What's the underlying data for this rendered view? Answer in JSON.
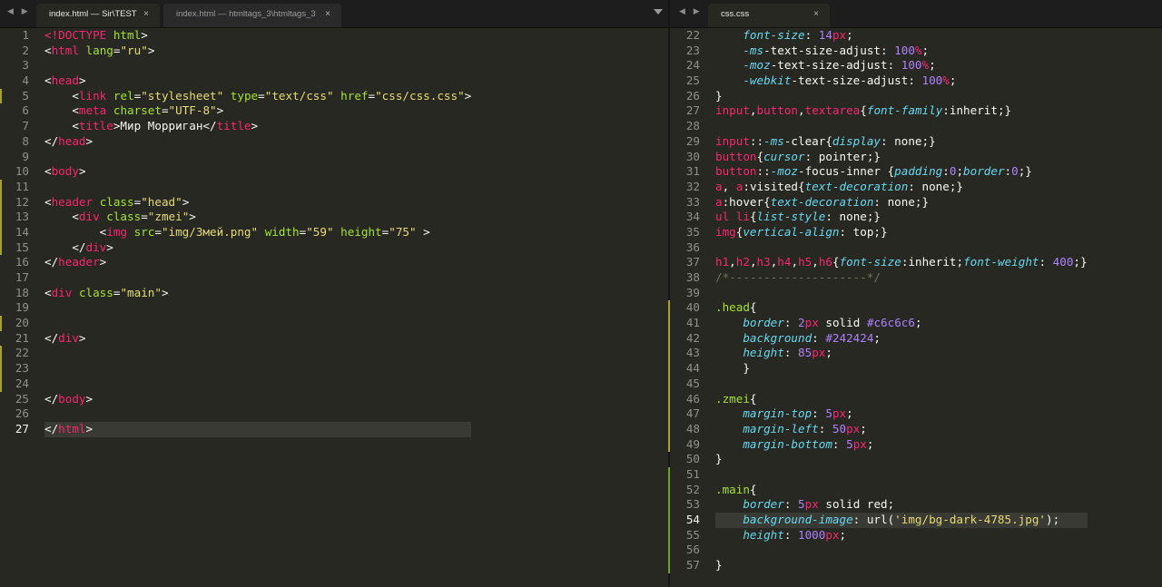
{
  "tabs": {
    "left": [
      {
        "label": "index.html — Sir\\TEST",
        "active": true
      },
      {
        "label": "index.html — htmltags_3\\htmltags_3",
        "active": false
      }
    ],
    "right": [
      {
        "label": "css.css",
        "active": true
      }
    ]
  },
  "icons": {
    "nav_arrows": "nav-arrows-icon",
    "close": "close-icon",
    "dropdown": "chevron-down-icon"
  },
  "colors": {
    "tag": "#f92672",
    "attribute": "#a6e22e",
    "string": "#e6db74",
    "property": "#66d9ef",
    "number": "#ae81ff",
    "comment": "#75715e",
    "background": "#272822",
    "gutter_modified": "#a6a22d",
    "gutter_added": "#6fa02a"
  },
  "html_editor": {
    "first_line": 1,
    "lines": [
      [
        [
          "t",
          "<!"
        ],
        [
          "t",
          "DOCTYPE"
        ],
        [
          "w",
          " "
        ],
        [
          "a",
          "html"
        ],
        [
          "w",
          ">"
        ]
      ],
      [
        [
          "w",
          "<"
        ],
        [
          "t",
          "html"
        ],
        [
          "w",
          " "
        ],
        [
          "a",
          "lang"
        ],
        [
          "w",
          "="
        ],
        [
          "s",
          "\"ru\""
        ],
        [
          "w",
          ">"
        ]
      ],
      [],
      [
        [
          "w",
          "<"
        ],
        [
          "t",
          "head"
        ],
        [
          "w",
          ">"
        ]
      ],
      [
        [
          "w",
          "    <"
        ],
        [
          "t",
          "link"
        ],
        [
          "w",
          " "
        ],
        [
          "a",
          "rel"
        ],
        [
          "w",
          "="
        ],
        [
          "s",
          "\"stylesheet\""
        ],
        [
          "w",
          " "
        ],
        [
          "a",
          "type"
        ],
        [
          "w",
          "="
        ],
        [
          "s",
          "\"text/css\""
        ],
        [
          "w",
          " "
        ],
        [
          "a",
          "href"
        ],
        [
          "w",
          "="
        ],
        [
          "s",
          "\"css/css.css\""
        ],
        [
          "w",
          ">"
        ]
      ],
      [
        [
          "w",
          "    <"
        ],
        [
          "t",
          "meta"
        ],
        [
          "w",
          " "
        ],
        [
          "a",
          "charset"
        ],
        [
          "w",
          "="
        ],
        [
          "s",
          "\"UTF-8\""
        ],
        [
          "w",
          ">"
        ]
      ],
      [
        [
          "w",
          "    <"
        ],
        [
          "t",
          "title"
        ],
        [
          "w",
          ">Мир Морриган</"
        ],
        [
          "t",
          "title"
        ],
        [
          "w",
          ">"
        ]
      ],
      [
        [
          "w",
          "</"
        ],
        [
          "t",
          "head"
        ],
        [
          "w",
          ">"
        ]
      ],
      [],
      [
        [
          "w",
          "<"
        ],
        [
          "t",
          "body"
        ],
        [
          "w",
          ">"
        ]
      ],
      [],
      [
        [
          "w",
          "<"
        ],
        [
          "t",
          "header"
        ],
        [
          "w",
          " "
        ],
        [
          "a",
          "class"
        ],
        [
          "w",
          "="
        ],
        [
          "s",
          "\"head\""
        ],
        [
          "w",
          ">"
        ]
      ],
      [
        [
          "w",
          "    <"
        ],
        [
          "t",
          "div"
        ],
        [
          "w",
          " "
        ],
        [
          "a",
          "class"
        ],
        [
          "w",
          "="
        ],
        [
          "s",
          "\"zmei\""
        ],
        [
          "w",
          ">"
        ]
      ],
      [
        [
          "w",
          "        <"
        ],
        [
          "t",
          "img"
        ],
        [
          "w",
          " "
        ],
        [
          "a",
          "src"
        ],
        [
          "w",
          "="
        ],
        [
          "s",
          "\"img/Змей.png\""
        ],
        [
          "w",
          " "
        ],
        [
          "a",
          "width"
        ],
        [
          "w",
          "="
        ],
        [
          "s",
          "\"59\""
        ],
        [
          "w",
          " "
        ],
        [
          "a",
          "height"
        ],
        [
          "w",
          "="
        ],
        [
          "s",
          "\"75\""
        ],
        [
          "w",
          " >"
        ]
      ],
      [
        [
          "w",
          "    </"
        ],
        [
          "t",
          "div"
        ],
        [
          "w",
          ">"
        ]
      ],
      [
        [
          "w",
          "</"
        ],
        [
          "t",
          "header"
        ],
        [
          "w",
          ">"
        ]
      ],
      [],
      [
        [
          "w",
          "<"
        ],
        [
          "t",
          "div"
        ],
        [
          "w",
          " "
        ],
        [
          "a",
          "class"
        ],
        [
          "w",
          "="
        ],
        [
          "s",
          "\"main\""
        ],
        [
          "w",
          ">"
        ]
      ],
      [],
      [],
      [
        [
          "w",
          "</"
        ],
        [
          "t",
          "div"
        ],
        [
          "w",
          ">"
        ]
      ],
      [],
      [],
      [],
      [
        [
          "w",
          "</"
        ],
        [
          "t",
          "body"
        ],
        [
          "w",
          ">"
        ]
      ],
      [],
      [
        [
          "w",
          "</"
        ],
        [
          "t",
          "html"
        ],
        [
          "w",
          ">"
        ]
      ]
    ],
    "modified_lines": [
      5,
      11,
      12,
      13,
      14,
      15,
      20,
      22,
      23,
      24
    ],
    "current_line": 27
  },
  "css_editor": {
    "first_line": 22,
    "lines": [
      [
        [
          "w",
          "    "
        ],
        [
          "p",
          "font-size"
        ],
        [
          "w",
          ": "
        ],
        [
          "n",
          "14"
        ],
        [
          "t",
          "px"
        ],
        [
          "w",
          ";"
        ]
      ],
      [
        [
          "w",
          "    "
        ],
        [
          "p",
          "-ms"
        ],
        [
          "w",
          "-text-size-adjust: "
        ],
        [
          "n",
          "100"
        ],
        [
          "t",
          "%"
        ],
        [
          "w",
          ";"
        ]
      ],
      [
        [
          "w",
          "    "
        ],
        [
          "p",
          "-moz"
        ],
        [
          "w",
          "-text-size-adjust: "
        ],
        [
          "n",
          "100"
        ],
        [
          "t",
          "%"
        ],
        [
          "w",
          ";"
        ]
      ],
      [
        [
          "w",
          "    "
        ],
        [
          "p",
          "-webkit"
        ],
        [
          "w",
          "-text-size-adjust: "
        ],
        [
          "n",
          "100"
        ],
        [
          "t",
          "%"
        ],
        [
          "w",
          ";"
        ]
      ],
      [
        [
          "w",
          "}"
        ]
      ],
      [
        [
          "t",
          "input"
        ],
        [
          "w",
          ","
        ],
        [
          "t",
          "button"
        ],
        [
          "w",
          ","
        ],
        [
          "t",
          "textarea"
        ],
        [
          "w",
          "{"
        ],
        [
          "p",
          "font-family"
        ],
        [
          "w",
          ":inherit;}"
        ]
      ],
      [],
      [
        [
          "t",
          "input"
        ],
        [
          "w",
          "::"
        ],
        [
          "p",
          "-ms"
        ],
        [
          "w",
          "-clear{"
        ],
        [
          "p",
          "display"
        ],
        [
          "w",
          ": none;}"
        ]
      ],
      [
        [
          "t",
          "button"
        ],
        [
          "w",
          "{"
        ],
        [
          "p",
          "cursor"
        ],
        [
          "w",
          ": pointer;}"
        ]
      ],
      [
        [
          "t",
          "button"
        ],
        [
          "w",
          "::"
        ],
        [
          "p",
          "-moz"
        ],
        [
          "w",
          "-focus-inner {"
        ],
        [
          "p",
          "padding"
        ],
        [
          "w",
          ":"
        ],
        [
          "n",
          "0"
        ],
        [
          "w",
          ";"
        ],
        [
          "p",
          "border"
        ],
        [
          "w",
          ":"
        ],
        [
          "n",
          "0"
        ],
        [
          "w",
          ";}"
        ]
      ],
      [
        [
          "t",
          "a"
        ],
        [
          "w",
          ", "
        ],
        [
          "t",
          "a"
        ],
        [
          "w",
          ":visited{"
        ],
        [
          "p",
          "text-decoration"
        ],
        [
          "w",
          ": none;}"
        ]
      ],
      [
        [
          "t",
          "a"
        ],
        [
          "w",
          ":hover{"
        ],
        [
          "p",
          "text-decoration"
        ],
        [
          "w",
          ": none;}"
        ]
      ],
      [
        [
          "t",
          "ul"
        ],
        [
          "w",
          " "
        ],
        [
          "t",
          "li"
        ],
        [
          "w",
          "{"
        ],
        [
          "p",
          "list-style"
        ],
        [
          "w",
          ": none;}"
        ]
      ],
      [
        [
          "t",
          "img"
        ],
        [
          "w",
          "{"
        ],
        [
          "p",
          "vertical-align"
        ],
        [
          "w",
          ": top;}"
        ]
      ],
      [],
      [
        [
          "t",
          "h1"
        ],
        [
          "w",
          ","
        ],
        [
          "t",
          "h2"
        ],
        [
          "w",
          ","
        ],
        [
          "t",
          "h3"
        ],
        [
          "w",
          ","
        ],
        [
          "t",
          "h4"
        ],
        [
          "w",
          ","
        ],
        [
          "t",
          "h5"
        ],
        [
          "w",
          ","
        ],
        [
          "t",
          "h6"
        ],
        [
          "w",
          "{"
        ],
        [
          "p",
          "font-size"
        ],
        [
          "w",
          ":inherit;"
        ],
        [
          "p",
          "font-weight"
        ],
        [
          "w",
          ": "
        ],
        [
          "n",
          "400"
        ],
        [
          "w",
          ";}"
        ]
      ],
      [
        [
          "c",
          "/*--------------------*/"
        ]
      ],
      [],
      [
        [
          "a",
          ".head"
        ],
        [
          "w",
          "{"
        ]
      ],
      [
        [
          "w",
          "    "
        ],
        [
          "p",
          "border"
        ],
        [
          "w",
          ": "
        ],
        [
          "n",
          "2"
        ],
        [
          "t",
          "px"
        ],
        [
          "w",
          " solid "
        ],
        [
          "n",
          "#c6c6c6"
        ],
        [
          "w",
          ";"
        ]
      ],
      [
        [
          "w",
          "    "
        ],
        [
          "p",
          "background"
        ],
        [
          "w",
          ": "
        ],
        [
          "n",
          "#242424"
        ],
        [
          "w",
          ";"
        ]
      ],
      [
        [
          "w",
          "    "
        ],
        [
          "p",
          "height"
        ],
        [
          "w",
          ": "
        ],
        [
          "n",
          "85"
        ],
        [
          "t",
          "px"
        ],
        [
          "w",
          ";"
        ]
      ],
      [
        [
          "w",
          "    }"
        ]
      ],
      [],
      [
        [
          "a",
          ".zmei"
        ],
        [
          "w",
          "{"
        ]
      ],
      [
        [
          "w",
          "    "
        ],
        [
          "p",
          "margin-top"
        ],
        [
          "w",
          ": "
        ],
        [
          "n",
          "5"
        ],
        [
          "t",
          "px"
        ],
        [
          "w",
          ";"
        ]
      ],
      [
        [
          "w",
          "    "
        ],
        [
          "p",
          "margin-left"
        ],
        [
          "w",
          ": "
        ],
        [
          "n",
          "50"
        ],
        [
          "t",
          "px"
        ],
        [
          "w",
          ";"
        ]
      ],
      [
        [
          "w",
          "    "
        ],
        [
          "p",
          "margin-bottom"
        ],
        [
          "w",
          ": "
        ],
        [
          "n",
          "5"
        ],
        [
          "t",
          "px"
        ],
        [
          "w",
          ";"
        ]
      ],
      [
        [
          "w",
          "}"
        ]
      ],
      [],
      [
        [
          "a",
          ".main"
        ],
        [
          "w",
          "{"
        ]
      ],
      [
        [
          "w",
          "    "
        ],
        [
          "p",
          "border"
        ],
        [
          "w",
          ": "
        ],
        [
          "n",
          "5"
        ],
        [
          "t",
          "px"
        ],
        [
          "w",
          " solid red;"
        ]
      ],
      [
        [
          "w",
          "    "
        ],
        [
          "p",
          "background-image"
        ],
        [
          "w",
          ": url("
        ],
        [
          "s",
          "'img/bg-dark-4785.jpg'"
        ],
        [
          "w",
          ");"
        ]
      ],
      [
        [
          "w",
          "    "
        ],
        [
          "p",
          "height"
        ],
        [
          "w",
          ": "
        ],
        [
          "n",
          "1000"
        ],
        [
          "t",
          "px"
        ],
        [
          "w",
          ";"
        ]
      ],
      [],
      [
        [
          "w",
          "}"
        ]
      ]
    ],
    "modified_lines": [
      40,
      41,
      42,
      43,
      44,
      45,
      46,
      47,
      48,
      49
    ],
    "added_lines": [
      51,
      52,
      53,
      54,
      55,
      56,
      57
    ],
    "current_line": 54
  }
}
